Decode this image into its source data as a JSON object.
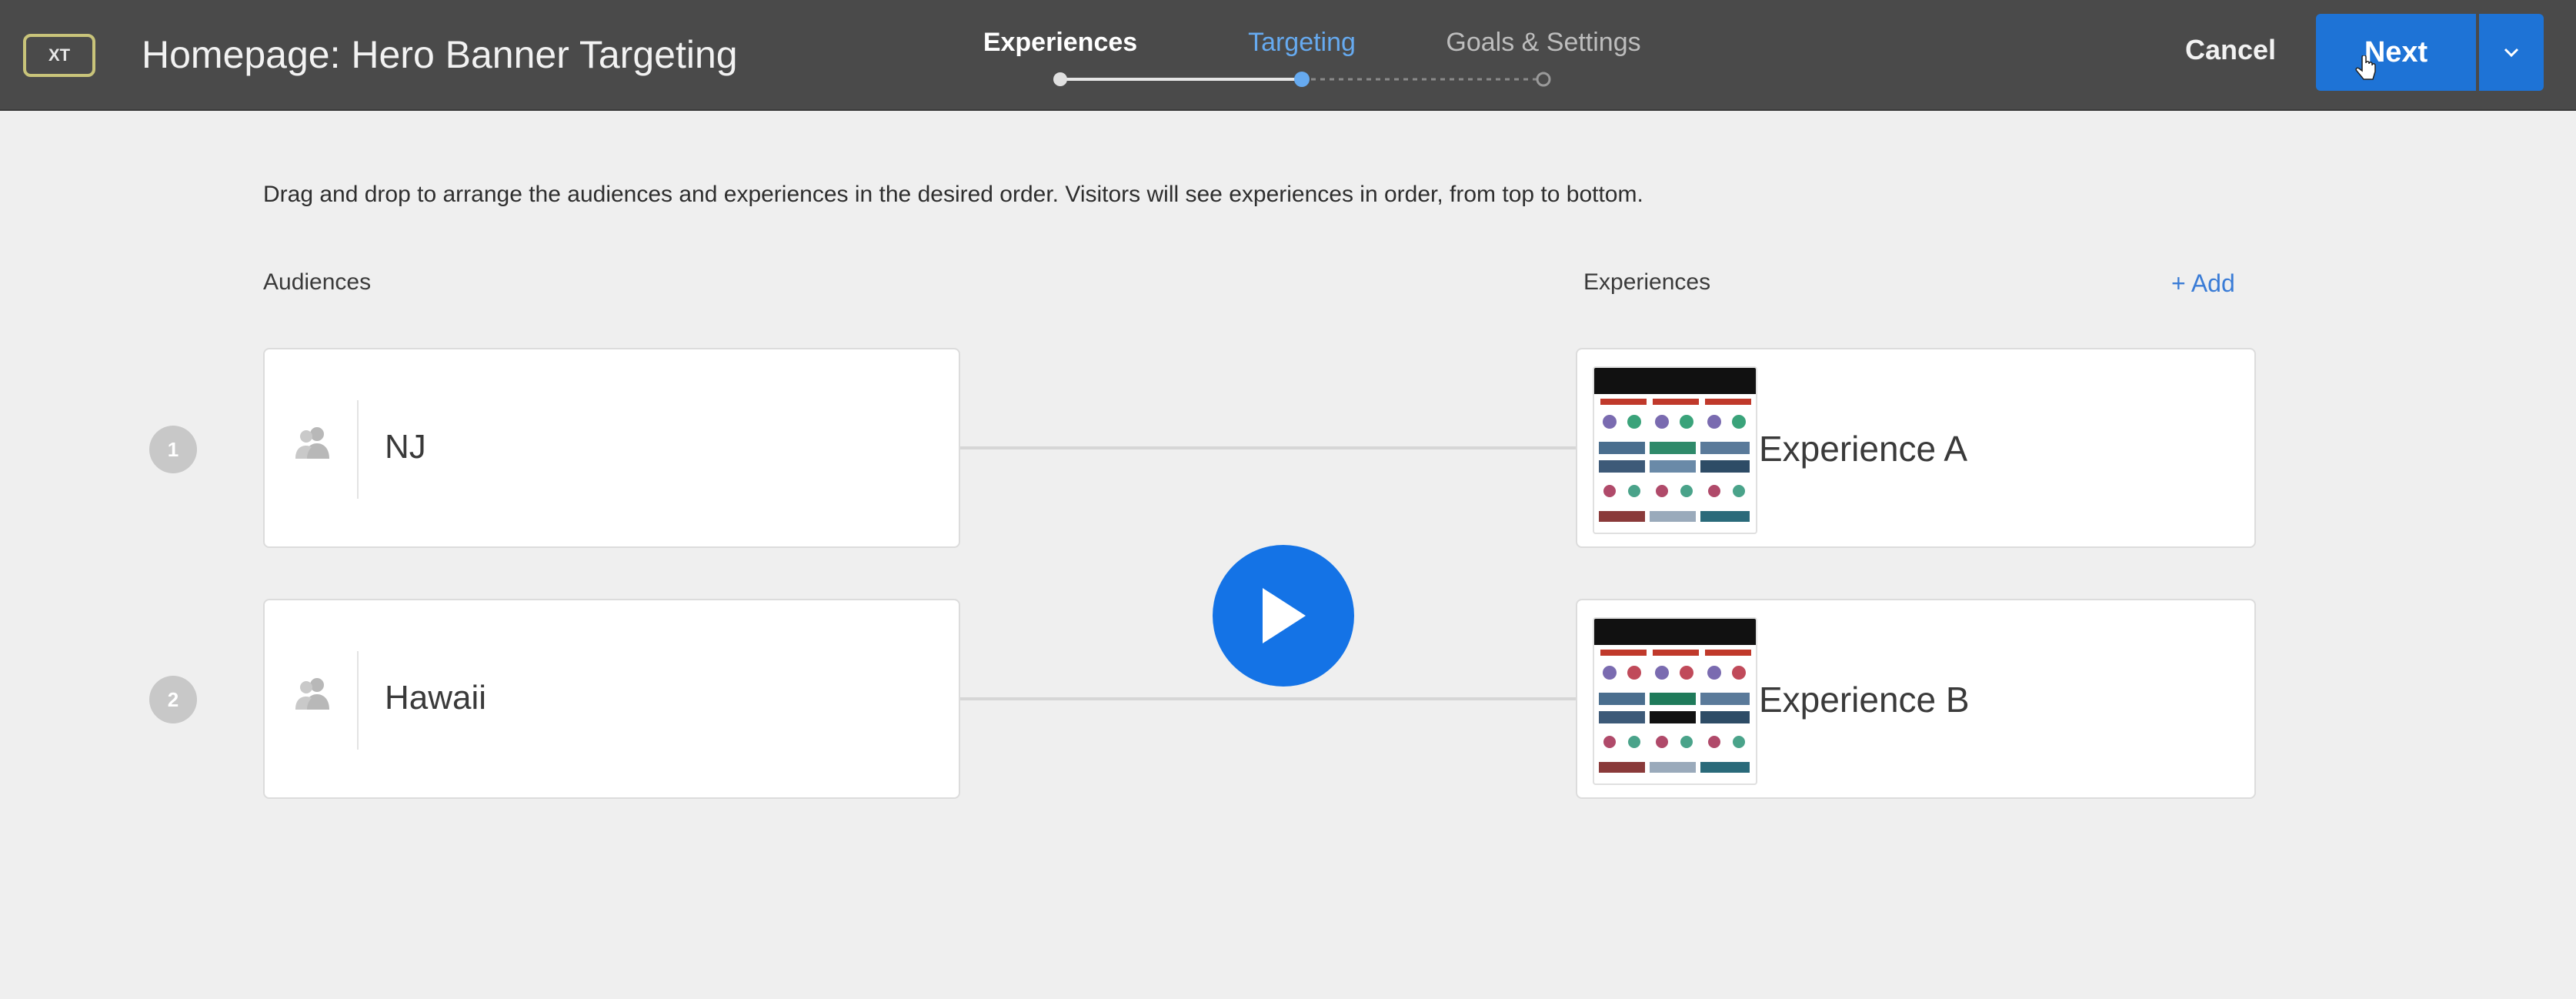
{
  "header": {
    "badge": "XT",
    "title": "Homepage: Hero Banner Targeting",
    "steps": [
      {
        "label": "Experiences",
        "state": "done"
      },
      {
        "label": "Targeting",
        "state": "active"
      },
      {
        "label": "Goals & Settings",
        "state": "pending"
      }
    ],
    "cancel_label": "Cancel",
    "next_label": "Next"
  },
  "main": {
    "instruction": "Drag and drop to arrange the audiences and experiences in the desired order. Visitors will see experiences in order, from top to bottom.",
    "audiences_label": "Audiences",
    "experiences_label": "Experiences",
    "add_label": "+ Add",
    "rows": [
      {
        "number": "1",
        "audience": "NJ",
        "experience": "Experience A"
      },
      {
        "number": "2",
        "audience": "Hawaii",
        "experience": "Experience B"
      }
    ]
  },
  "colors": {
    "topbar": "#4a4a4a",
    "accent": "#1e73d6",
    "active_step": "#66aaf0",
    "background": "#efefef"
  },
  "icons": {
    "audience": "users-icon",
    "play": "play-icon",
    "dropdown": "chevron-down-icon"
  }
}
